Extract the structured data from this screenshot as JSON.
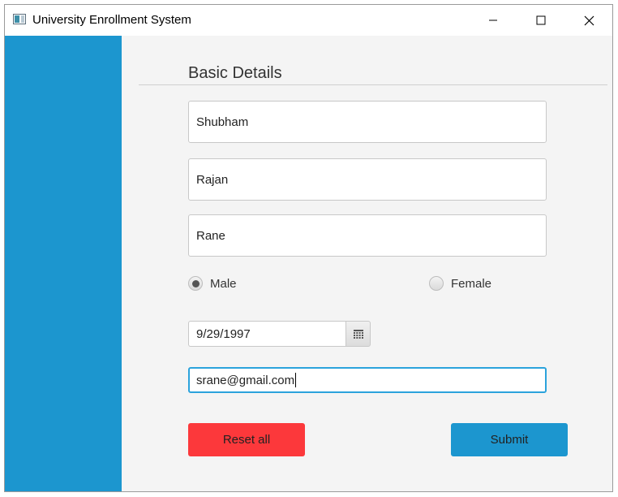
{
  "window": {
    "title": "University Enrollment System",
    "icons": {
      "app": "app-window-icon",
      "minimize": "minimize-icon",
      "maximize": "maximize-icon",
      "close": "close-icon"
    }
  },
  "colors": {
    "sidebar": "#1c96cf",
    "reset_button": "#fc383b",
    "submit_button": "#1c96cf",
    "focus_border": "#2ba3dc"
  },
  "form": {
    "section_title": "Basic Details",
    "first_name": "Shubham",
    "middle_name": "Rajan",
    "last_name": "Rane",
    "gender": {
      "options": [
        "Male",
        "Female"
      ],
      "selected": "Male"
    },
    "date_of_birth": "9/29/1997",
    "date_picker_icon": "calendar-icon",
    "email": "srane@gmail.com",
    "buttons": {
      "reset": "Reset all",
      "submit": "Submit"
    }
  }
}
